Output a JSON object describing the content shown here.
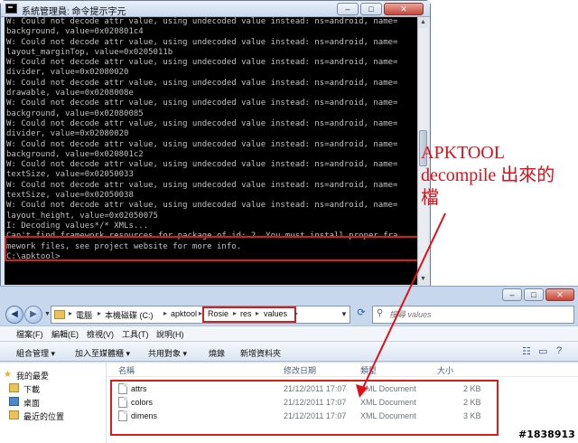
{
  "console": {
    "title": "系統管理員: 命令提示字元",
    "icon": "console-icon",
    "lines": [
      "W: Could not decode attr value, using undecoded value instead: ns=android, name=",
      "background, value=0x020801c4",
      "W: Could not decode attr value, using undecoded value instead: ns=android, name=",
      "layout_marginTop, value=0x0205011b",
      "W: Could not decode attr value, using undecoded value instead: ns=android, name=",
      "divider, value=0x02080020",
      "W: Could not decode attr value, using undecoded value instead: ns=android, name=",
      "drawable, value=0x0208008e",
      "W: Could not decode attr value, using undecoded value instead: ns=android, name=",
      "background, value=0x02080085",
      "W: Could not decode attr value, using undecoded value instead: ns=android, name=",
      "divider, value=0x02080020",
      "W: Could not decode attr value, using undecoded value instead: ns=android, name=",
      "background, value=0x020801c2",
      "W: Could not decode attr value, using undecoded value instead: ns=android, name=",
      "textSize, value=0x02050033",
      "W: Could not decode attr value, using undecoded value instead: ns=android, name=",
      "textSize, value=0x02050038",
      "W: Could not decode attr value, using undecoded value instead: ns=android, name=",
      "layout_height, value=0x02050075",
      "I: Decoding values*/* XMLs...",
      "Can't find framework resources for package of id: 2. You must install proper fra",
      "mework files, see project website for more info.",
      "",
      "C:\\apktool>"
    ]
  },
  "annotation": {
    "line1": "APKTOOL",
    "line2": "decompile 出來的",
    "line3": "檔",
    "color": "#e0101a"
  },
  "explorer": {
    "breadcrumbs": [
      "電腦",
      "本機磁碟 (C:)",
      "apktool",
      "Rosie",
      "res",
      "values"
    ],
    "search_placeholder": "搜尋 values",
    "menu": [
      "檔案(F)",
      "編輯(E)",
      "檢視(V)",
      "工具(T)",
      "說明(H)"
    ],
    "toolbar": [
      "組合管理 ▾",
      "加入至媒體櫃 ▾",
      "共用對象 ▾",
      "燒錄",
      "新增資料夾"
    ],
    "nav": [
      "我的最愛",
      "下載",
      "桌面",
      "最近的位置"
    ],
    "columns": {
      "name": "名稱",
      "modified": "修改日期",
      "type": "類型",
      "size": "大小"
    },
    "files": [
      {
        "name": "attrs",
        "modified": "21/12/2011 17:07",
        "type": "XML Document",
        "size": "2 KB"
      },
      {
        "name": "colors",
        "modified": "21/12/2011 17:07",
        "type": "XML Document",
        "size": "2 KB"
      },
      {
        "name": "dimens",
        "modified": "21/12/2011 17:07",
        "type": "XML Document",
        "size": "3 KB"
      }
    ]
  },
  "watermark": "#1838913"
}
